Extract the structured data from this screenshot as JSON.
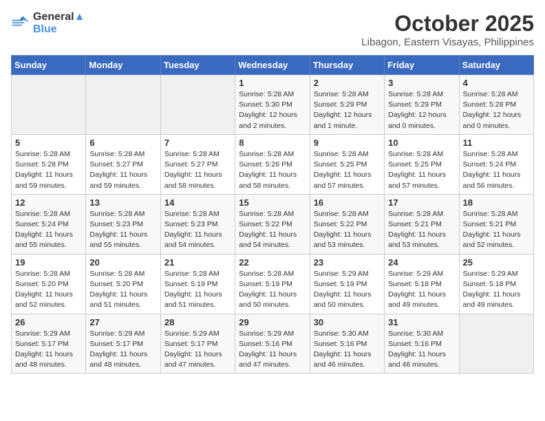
{
  "header": {
    "logo_line1": "General",
    "logo_line2": "Blue",
    "month_title": "October 2025",
    "location": "Libagon, Eastern Visayas, Philippines"
  },
  "calendar": {
    "days_of_week": [
      "Sunday",
      "Monday",
      "Tuesday",
      "Wednesday",
      "Thursday",
      "Friday",
      "Saturday"
    ],
    "weeks": [
      [
        {
          "day": "",
          "content": ""
        },
        {
          "day": "",
          "content": ""
        },
        {
          "day": "",
          "content": ""
        },
        {
          "day": "1",
          "content": "Sunrise: 5:28 AM\nSunset: 5:30 PM\nDaylight: 12 hours\nand 2 minutes."
        },
        {
          "day": "2",
          "content": "Sunrise: 5:28 AM\nSunset: 5:29 PM\nDaylight: 12 hours\nand 1 minute."
        },
        {
          "day": "3",
          "content": "Sunrise: 5:28 AM\nSunset: 5:29 PM\nDaylight: 12 hours\nand 0 minutes."
        },
        {
          "day": "4",
          "content": "Sunrise: 5:28 AM\nSunset: 5:28 PM\nDaylight: 12 hours\nand 0 minutes."
        }
      ],
      [
        {
          "day": "5",
          "content": "Sunrise: 5:28 AM\nSunset: 5:28 PM\nDaylight: 11 hours\nand 59 minutes."
        },
        {
          "day": "6",
          "content": "Sunrise: 5:28 AM\nSunset: 5:27 PM\nDaylight: 11 hours\nand 59 minutes."
        },
        {
          "day": "7",
          "content": "Sunrise: 5:28 AM\nSunset: 5:27 PM\nDaylight: 11 hours\nand 58 minutes."
        },
        {
          "day": "8",
          "content": "Sunrise: 5:28 AM\nSunset: 5:26 PM\nDaylight: 11 hours\nand 58 minutes."
        },
        {
          "day": "9",
          "content": "Sunrise: 5:28 AM\nSunset: 5:25 PM\nDaylight: 11 hours\nand 57 minutes."
        },
        {
          "day": "10",
          "content": "Sunrise: 5:28 AM\nSunset: 5:25 PM\nDaylight: 11 hours\nand 57 minutes."
        },
        {
          "day": "11",
          "content": "Sunrise: 5:28 AM\nSunset: 5:24 PM\nDaylight: 11 hours\nand 56 minutes."
        }
      ],
      [
        {
          "day": "12",
          "content": "Sunrise: 5:28 AM\nSunset: 5:24 PM\nDaylight: 11 hours\nand 55 minutes."
        },
        {
          "day": "13",
          "content": "Sunrise: 5:28 AM\nSunset: 5:23 PM\nDaylight: 11 hours\nand 55 minutes."
        },
        {
          "day": "14",
          "content": "Sunrise: 5:28 AM\nSunset: 5:23 PM\nDaylight: 11 hours\nand 54 minutes."
        },
        {
          "day": "15",
          "content": "Sunrise: 5:28 AM\nSunset: 5:22 PM\nDaylight: 11 hours\nand 54 minutes."
        },
        {
          "day": "16",
          "content": "Sunrise: 5:28 AM\nSunset: 5:22 PM\nDaylight: 11 hours\nand 53 minutes."
        },
        {
          "day": "17",
          "content": "Sunrise: 5:28 AM\nSunset: 5:21 PM\nDaylight: 11 hours\nand 53 minutes."
        },
        {
          "day": "18",
          "content": "Sunrise: 5:28 AM\nSunset: 5:21 PM\nDaylight: 11 hours\nand 52 minutes."
        }
      ],
      [
        {
          "day": "19",
          "content": "Sunrise: 5:28 AM\nSunset: 5:20 PM\nDaylight: 11 hours\nand 52 minutes."
        },
        {
          "day": "20",
          "content": "Sunrise: 5:28 AM\nSunset: 5:20 PM\nDaylight: 11 hours\nand 51 minutes."
        },
        {
          "day": "21",
          "content": "Sunrise: 5:28 AM\nSunset: 5:19 PM\nDaylight: 11 hours\nand 51 minutes."
        },
        {
          "day": "22",
          "content": "Sunrise: 5:28 AM\nSunset: 5:19 PM\nDaylight: 11 hours\nand 50 minutes."
        },
        {
          "day": "23",
          "content": "Sunrise: 5:29 AM\nSunset: 5:19 PM\nDaylight: 11 hours\nand 50 minutes."
        },
        {
          "day": "24",
          "content": "Sunrise: 5:29 AM\nSunset: 5:18 PM\nDaylight: 11 hours\nand 49 minutes."
        },
        {
          "day": "25",
          "content": "Sunrise: 5:29 AM\nSunset: 5:18 PM\nDaylight: 11 hours\nand 49 minutes."
        }
      ],
      [
        {
          "day": "26",
          "content": "Sunrise: 5:29 AM\nSunset: 5:17 PM\nDaylight: 11 hours\nand 48 minutes."
        },
        {
          "day": "27",
          "content": "Sunrise: 5:29 AM\nSunset: 5:17 PM\nDaylight: 11 hours\nand 48 minutes."
        },
        {
          "day": "28",
          "content": "Sunrise: 5:29 AM\nSunset: 5:17 PM\nDaylight: 11 hours\nand 47 minutes."
        },
        {
          "day": "29",
          "content": "Sunrise: 5:29 AM\nSunset: 5:16 PM\nDaylight: 11 hours\nand 47 minutes."
        },
        {
          "day": "30",
          "content": "Sunrise: 5:30 AM\nSunset: 5:16 PM\nDaylight: 11 hours\nand 46 minutes."
        },
        {
          "day": "31",
          "content": "Sunrise: 5:30 AM\nSunset: 5:16 PM\nDaylight: 11 hours\nand 46 minutes."
        },
        {
          "day": "",
          "content": ""
        }
      ]
    ]
  }
}
